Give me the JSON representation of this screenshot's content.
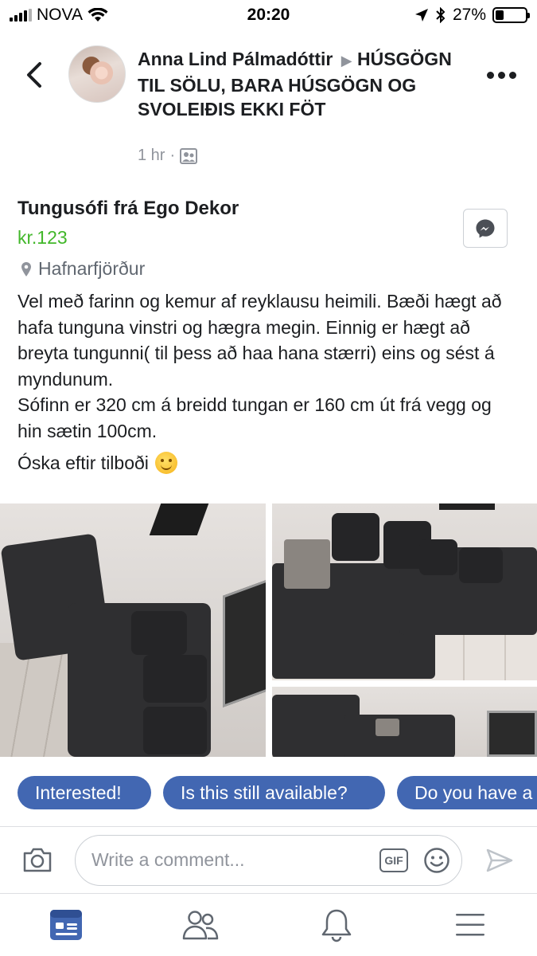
{
  "status_bar": {
    "carrier": "NOVA",
    "time": "20:20",
    "battery_percent": "27%",
    "battery_level": 0.27
  },
  "post": {
    "author": "Anna Lind Pálmadóttir",
    "group": "HÚSGÖGN TIL SÖLU, BARA HÚSGÖGN OG SVOLEIÐIS EKKI FÖT",
    "time_ago": "1 hr",
    "separator": "·"
  },
  "listing": {
    "title": "Tungusófi frá Ego Dekor",
    "price": "kr.123",
    "location": "Hafnarfjörður",
    "description_lines": [
      "Vel með farinn og kemur af reyklausu heimili. Bæði hægt að hafa tunguna vinstri og hægra megin. Einnig er hægt að breyta tungunni( til þess að haa hana stærri) eins og sést á myndunum.",
      "Sófinn er 320 cm á breidd tungan er 160 cm út frá vegg og hin sætin 100cm."
    ],
    "closing": "Óska eftir tilboði"
  },
  "quick_replies": [
    "Interested!",
    "Is this still available?",
    "Do you have a"
  ],
  "comment": {
    "placeholder": "Write a comment...",
    "gif_label": "GIF"
  },
  "icons": {
    "back": "chevron-left-icon",
    "more": "more-dots-icon",
    "messenger": "messenger-icon",
    "location": "location-pin-icon",
    "audience": "group-audience-icon",
    "camera": "camera-icon",
    "emoji": "smiley-icon",
    "send": "send-icon",
    "feed": "news-feed-icon",
    "friends": "friends-icon",
    "notifications": "bell-icon",
    "menu": "hamburger-menu-icon"
  },
  "colors": {
    "accent": "#4267b2",
    "price": "#42b72a",
    "muted": "#90949c"
  }
}
